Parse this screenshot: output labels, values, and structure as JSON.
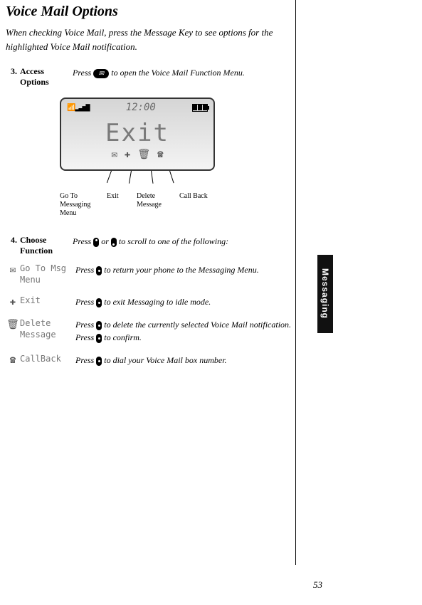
{
  "title": "Voice Mail Options",
  "intro": "When checking Voice Mail, press the Message Key to see options for the highlighted Voice Mail notification.",
  "steps": {
    "s3": {
      "num": "3.",
      "label": "Access Options",
      "desc_a": "Press ",
      "desc_b": " to open the Voice Mail Function Menu."
    },
    "s4": {
      "num": "4.",
      "label": "Choose Function",
      "desc_a": "Press ",
      "desc_mid": " or ",
      "desc_b": " to scroll to one of the following:"
    }
  },
  "screen": {
    "time": "12:00",
    "main_text": "Exit",
    "annot1": "Go To Messaging Menu",
    "annot2": "Exit",
    "annot3": "Delete Message",
    "annot4": "Call Back"
  },
  "funcs": {
    "goto": {
      "label_a": "Go To Msg",
      "label_b": "Menu",
      "desc_a": "Press ",
      "desc_b": " to return your phone to the Messaging Menu."
    },
    "exit": {
      "label": "Exit",
      "desc_a": "Press ",
      "desc_b": " to exit Messaging to idle mode."
    },
    "delete": {
      "label_a": "Delete",
      "label_b": "Message",
      "desc_a": "Press ",
      "desc_b": " to delete the currently selected Voice Mail notification. Press ",
      "desc_c": " to confirm."
    },
    "callback": {
      "label": "CallBack",
      "desc_a": "Press ",
      "desc_b": " to dial your Voice Mail box number."
    }
  },
  "side_tab": "Messaging",
  "page_number": "53"
}
